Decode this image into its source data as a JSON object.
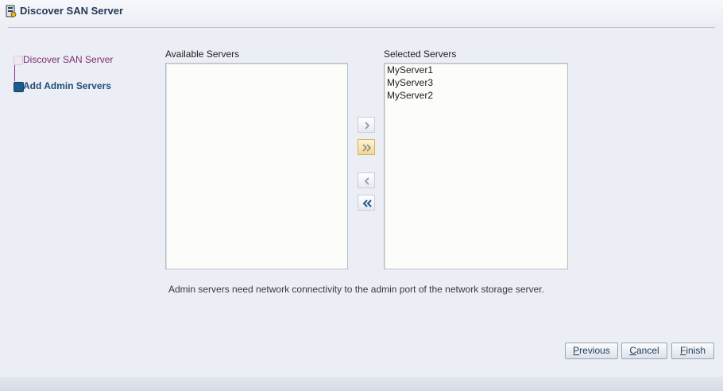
{
  "window": {
    "title": "Discover SAN Server"
  },
  "train": {
    "steps": [
      {
        "label": "Discover SAN Server",
        "state": "visited"
      },
      {
        "label": "Add Admin Servers",
        "state": "current"
      }
    ]
  },
  "shuttle": {
    "available": {
      "label": "Available Servers",
      "items": []
    },
    "selected": {
      "label": "Selected Servers",
      "items": [
        "MyServer1",
        "MyServer3",
        "MyServer2"
      ]
    },
    "buttons": [
      "move-icon",
      "move-all-icon",
      "remove-icon",
      "remove-all-icon"
    ]
  },
  "hint": "Admin servers need network connectivity to the admin port of the network storage server.",
  "buttons": {
    "previous": {
      "first": "P",
      "rest": "revious"
    },
    "cancel": {
      "first": "C",
      "rest": "ancel"
    },
    "finish": {
      "first": "F",
      "rest": "inish"
    }
  },
  "colors": {
    "accent": "#1e5b8d",
    "visited_step": "#7a2d72",
    "background": "#eceef5"
  }
}
